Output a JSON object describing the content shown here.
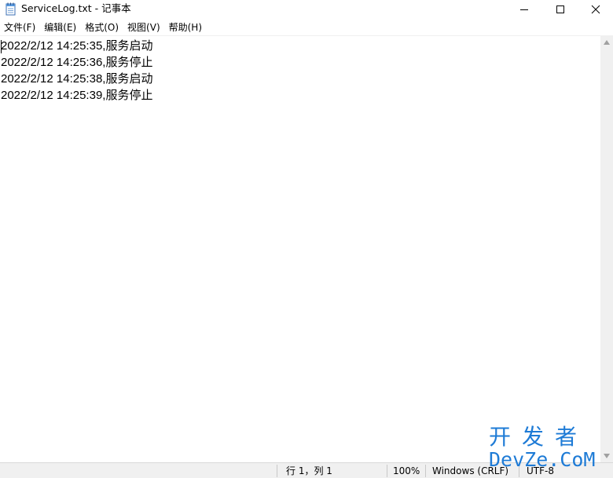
{
  "window": {
    "title": "ServiceLog.txt - 记事本",
    "icon": "notepad-icon"
  },
  "menu": {
    "items": [
      "文件(F)",
      "编辑(E)",
      "格式(O)",
      "视图(V)",
      "帮助(H)"
    ]
  },
  "editor": {
    "lines": [
      "2022/2/12 14:25:35,服务启动",
      "2022/2/12 14:25:36,服务停止",
      "2022/2/12 14:25:38,服务启动",
      "2022/2/12 14:25:39,服务停止"
    ]
  },
  "status": {
    "position": "行 1，列 1",
    "zoom": "100%",
    "line_ending": "Windows (CRLF)",
    "encoding": "UTF-8"
  },
  "watermark": {
    "chinese": "开发者",
    "english": "DevZe.CoM"
  },
  "colors": {
    "watermark": "#1e7bd6",
    "statusbar_bg": "#f0f0f0"
  }
}
